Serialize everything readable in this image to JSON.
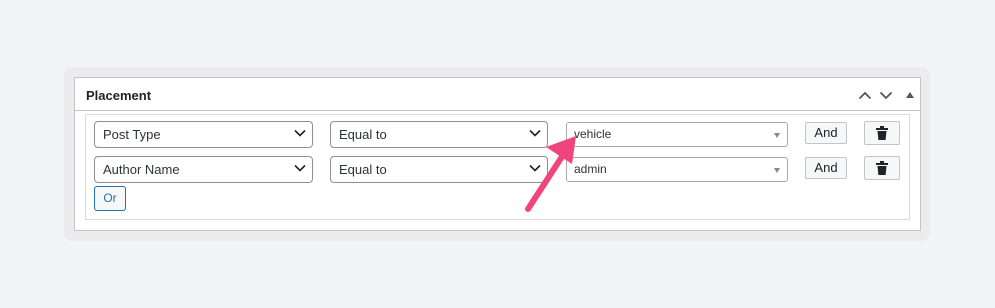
{
  "panel": {
    "title": "Placement",
    "icons": [
      "chevron-up-icon",
      "chevron-down-icon",
      "triangle-up-icon"
    ]
  },
  "rules": [
    {
      "field": "Post Type",
      "operator": "Equal to",
      "value": "vehicle",
      "and_label": "And",
      "delete_icon": "trash-icon"
    },
    {
      "field": "Author Name",
      "operator": "Equal to",
      "value": "admin",
      "and_label": "And",
      "delete_icon": "trash-icon"
    }
  ],
  "or_label": "Or",
  "colors": {
    "accent": "#2271b1",
    "annotation_arrow": "#f0457a",
    "background": "#f3f4f6"
  }
}
